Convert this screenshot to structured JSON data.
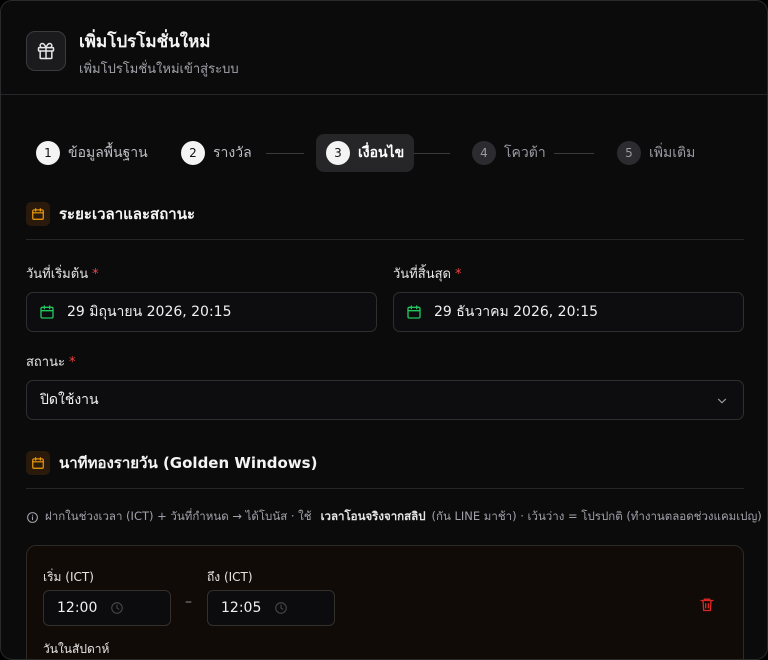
{
  "header": {
    "icon": "gift-icon",
    "title": "เพิ่มโปรโมชั่นใหม่",
    "subtitle": "เพิ่มโปรโมชั่นใหม่เข้าสู่ระบบ"
  },
  "stepper": {
    "steps": [
      {
        "number": "1",
        "label": "ข้อมูลพื้นฐาน",
        "state": "done"
      },
      {
        "number": "2",
        "label": "รางวัล",
        "state": "done"
      },
      {
        "number": "3",
        "label": "เงื่อนไข",
        "state": "active"
      },
      {
        "number": "4",
        "label": "โควต้า",
        "state": "todo"
      },
      {
        "number": "5",
        "label": "เพิ่มเติม",
        "state": "todo"
      }
    ]
  },
  "period_section": {
    "icon": "calendar-icon",
    "title": "ระยะเวลาและสถานะ",
    "start_label": "วันที่เริ่มต้น",
    "start_value": "29 มิถุนายน 2026, 20:15",
    "end_label": "วันที่สิ้นสุด",
    "end_value": "29 ธันวาคม 2026, 20:15",
    "required_mark": "*",
    "status_label": "สถานะ",
    "status_value": "ปิดใช้งาน"
  },
  "golden_section": {
    "icon": "calendar-icon",
    "title": "นาทีทองรายวัน (Golden Windows)",
    "hint_prefix": "ฝากในช่วงเวลา (ICT) + วันที่กำหนด → ได้โบนัส · ใช้",
    "hint_bold": "เวลาโอนจริงจากสลิป",
    "hint_suffix": "(กัน LINE มาช้า) · เว้นว่าง = โปรปกติ (ทำงานตลอดช่วงแคมเปญ)",
    "window": {
      "start_label": "เริ่ม (ICT)",
      "start_value": "12:00",
      "end_label": "ถึง (ICT)",
      "end_value": "12:05",
      "separator": "–",
      "days_label": "วันในสัปดาห์"
    }
  },
  "colors": {
    "accent_orange": "#f59e0b",
    "calendar_green": "#22c55e",
    "required_red": "#ef4444",
    "trash_red": "#dc2626"
  }
}
